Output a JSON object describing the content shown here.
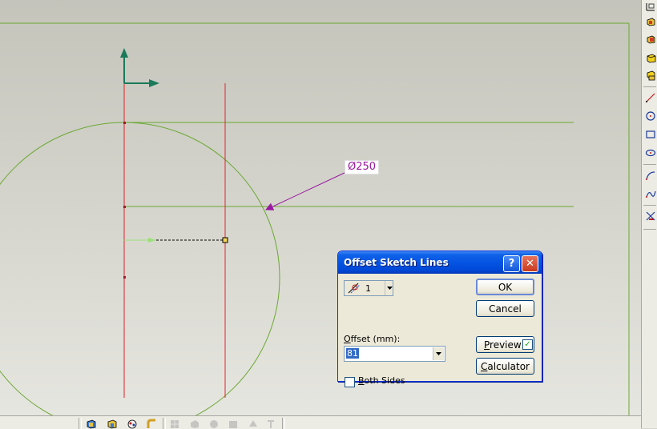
{
  "sketch": {
    "dimension_label": "Ø250",
    "colors": {
      "construction_line": "#e2232a",
      "circle": "#6aa831",
      "offset_line": "#6aa831",
      "dimension": "#9a19a0",
      "axis": "#1a7a5a"
    }
  },
  "dialog": {
    "title": "Offset Sketch Lines",
    "help_glyph": "?",
    "close_glyph": "✕",
    "count_value": "1",
    "offset_label_prefix": "",
    "offset_label_hotkey": "O",
    "offset_label_rest": "ffset (mm):",
    "offset_value": "81",
    "both_sides_hotkey": "B",
    "both_sides_rest": "oth Sides",
    "both_sides_checked": false,
    "ok_label": "OK",
    "cancel_label": "Cancel",
    "preview_hotkey": "P",
    "preview_rest": "review",
    "preview_checked": true,
    "calculator_hotkey": "C",
    "calculator_rest": "alculator"
  },
  "toolbars": {
    "right_icons": [
      "sketch-plane-icon",
      "extrude-icon",
      "revolve-icon",
      "shell-icon",
      "boolean-icon",
      "line-icon",
      "circle-icon",
      "rectangle-icon",
      "ellipse-icon",
      "arc-icon",
      "spline-icon",
      "trim-icon"
    ],
    "bottom_icons": [
      "view-cube-icon",
      "render-icon",
      "material-icon",
      "pipe-icon",
      "grid-icon",
      "hide-icon",
      "disk-icon",
      "save-icon",
      "sphere-icon",
      "text-icon"
    ]
  }
}
